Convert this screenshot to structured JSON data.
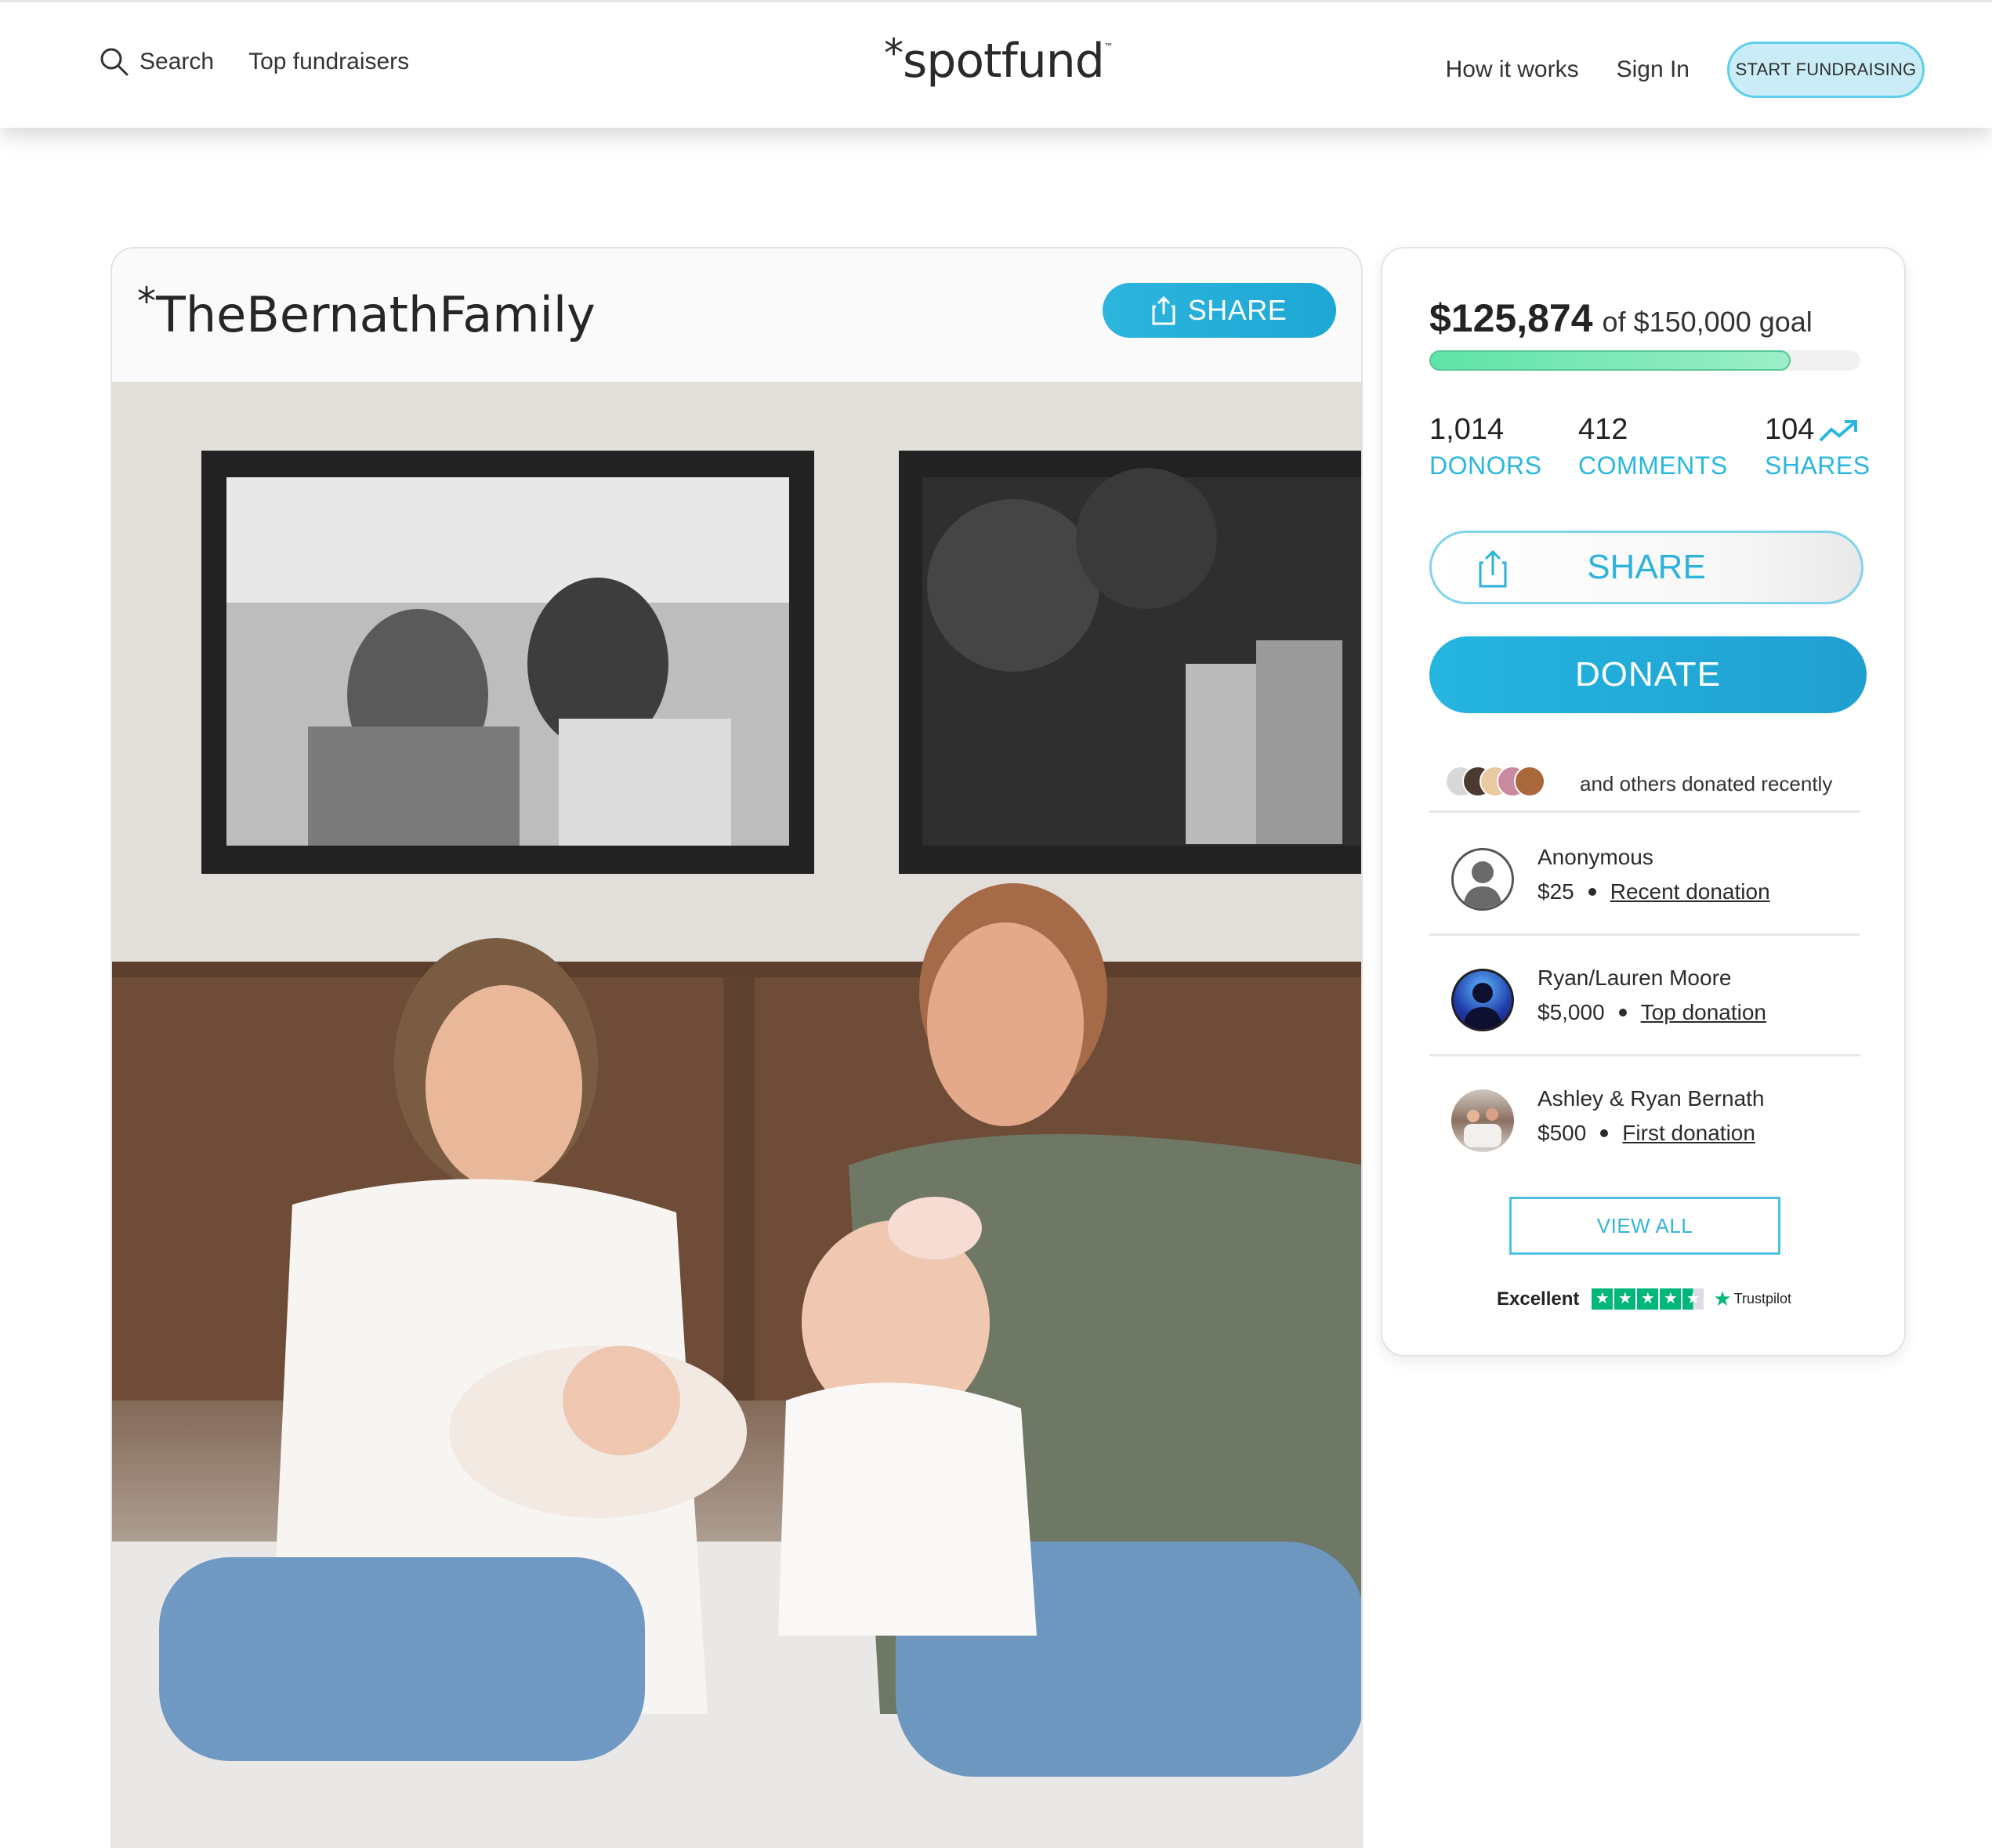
{
  "header": {
    "search_label": "Search",
    "top_fundraisers": "Top fundraisers",
    "logo": "spotfund",
    "logo_star": "*",
    "logo_tm": "™",
    "how_it_works": "How it works",
    "sign_in": "Sign In",
    "start_fundraising": "START FUNDRAISING"
  },
  "campaign": {
    "title_star": "*",
    "title": "TheBernathFamily",
    "share_label": "SHARE"
  },
  "sidebar": {
    "raised": "$125,874",
    "goal_text": "of $150,000 goal",
    "progress_fraction": 0.839,
    "stats": {
      "donors_count": "1,014",
      "donors_label": "DONORS",
      "comments_count": "412",
      "comments_label": "COMMENTS",
      "shares_count": "104",
      "shares_label": "SHARES"
    },
    "share_label": "SHARE",
    "donate_label": "DONATE",
    "recent_text": "and others donated recently",
    "donations": [
      {
        "name": "Anonymous",
        "amount": "$25",
        "tag": "Recent donation",
        "avatar": "default-avatar"
      },
      {
        "name": "Ryan/Lauren Moore",
        "amount": "$5,000",
        "tag": "Top donation",
        "avatar": "silhouette-avatar"
      },
      {
        "name": "Ashley & Ryan Bernath",
        "amount": "$500",
        "tag": "First donation",
        "avatar": "family-photo-avatar"
      }
    ],
    "view_all": "VIEW ALL",
    "trustpilot_rating": "Excellent",
    "trustpilot_name": "Trustpilot",
    "trustpilot_stars": 4.5
  },
  "colors": {
    "accent": "#29b7df",
    "progress": "#7fe8b8",
    "trustpilot_green": "#00b67a"
  }
}
